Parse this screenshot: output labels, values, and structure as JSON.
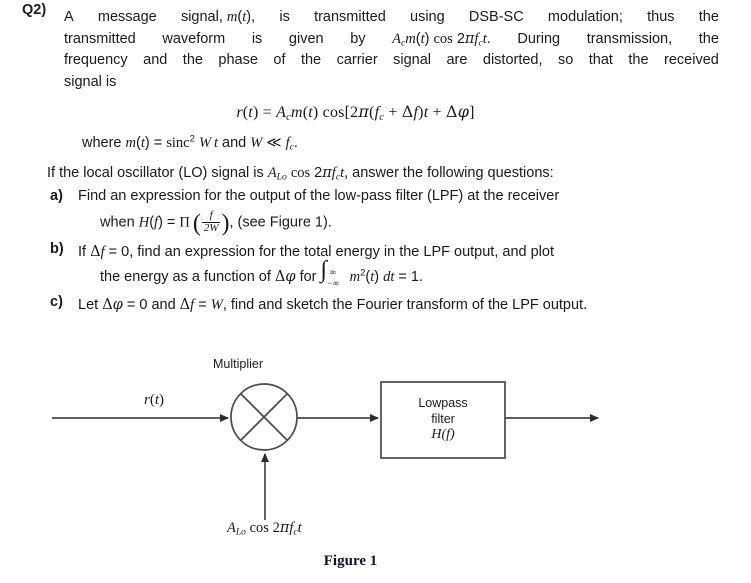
{
  "question": {
    "label": "Q2)",
    "intro_line1": "A message signal, m(t), is transmitted using DSB-SC modulation; thus the",
    "intro_line2": "transmitted waveform is given by Acm(t) cos 2πfct. During transmission, the",
    "intro_line3": "frequency and the phase of the carrier signal are distorted, so that the received",
    "intro_line4": "signal is",
    "main_equation": "r(t) = Aᴄm(t) cos[2π(fc + Δf)t + Δϕ]",
    "where_line": "where m(t) = sinc² Wt and W ≪ fc.",
    "lo_line": "If the local oscillator (LO) signal is Aʟᴏ cos 2πfct, answer the following questions:",
    "parts": [
      {
        "bullet": "a)",
        "line1": "Find an expression for the output of the low-pass filter (LPF) at the receiver",
        "line2": "when H(f) = Π (f/2W), (see Figure 1)."
      },
      {
        "bullet": "b)",
        "line1": "If Δf = 0, find an expression for the total energy in the LPF output, and plot",
        "line2": "the energy as a function of Δϕ for ∫₋∞⁺∞ m²(t) dt = 1."
      },
      {
        "bullet": "c)",
        "line1": "Let Δϕ = 0 and Δf = W, find and sketch the Fourier transform of the LPF output.",
        "line2": ""
      }
    ]
  },
  "figure": {
    "multiplier_label": "Multiplier",
    "input_label": "r(t)",
    "lpf_line1": "Lowpass",
    "lpf_line2": "filter",
    "lpf_line3": "H(f)",
    "lo_label": "Aʟᴏ cos 2πfct",
    "caption": "Figure 1"
  },
  "colors": {
    "text": "#1b1b1b",
    "diagram_stroke": "#4a4a4a",
    "caption": "#141428",
    "background": "#ffffff"
  }
}
